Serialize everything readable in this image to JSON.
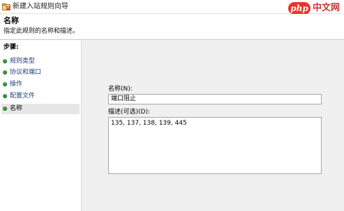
{
  "window": {
    "title": "新建入站规则向导",
    "icon": "firewall-wizard-icon"
  },
  "watermark": {
    "logo_text": "php",
    "site_text": "中文网"
  },
  "header": {
    "title": "名称",
    "description": "指定此规则的名称和描述。"
  },
  "sidebar": {
    "steps_title": "步骤:",
    "steps": [
      {
        "label": "规则类型",
        "active": false
      },
      {
        "label": "协议和端口",
        "active": false
      },
      {
        "label": "操作",
        "active": false
      },
      {
        "label": "配置文件",
        "active": false
      },
      {
        "label": "名称",
        "active": true
      }
    ]
  },
  "form": {
    "name_label": "名称(N):",
    "name_value": "端口阻止",
    "description_label": "描述(可选)(D):",
    "description_value": "135, 137, 138, 139, 445"
  },
  "colors": {
    "step_bullet": "#3d9a3d",
    "step_link": "#22407a",
    "active_step_bg": "#e6e6e6",
    "watermark_red": "#e8352b"
  }
}
